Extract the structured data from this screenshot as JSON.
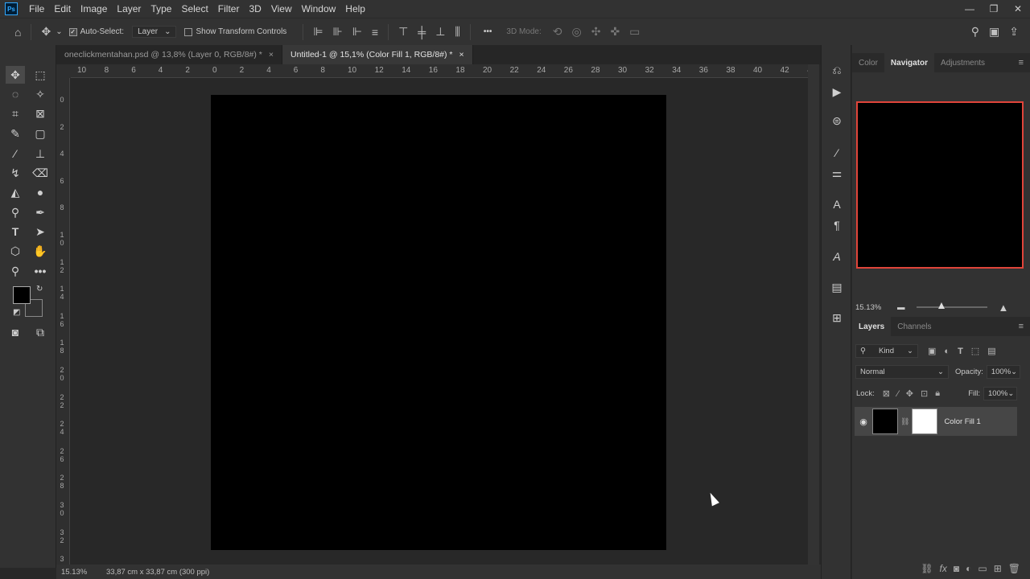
{
  "app": {
    "logo": "Ps"
  },
  "menu": [
    "File",
    "Edit",
    "Image",
    "Layer",
    "Type",
    "Select",
    "Filter",
    "3D",
    "View",
    "Window",
    "Help"
  ],
  "window_controls": {
    "minimize": "—",
    "restore": "❐",
    "close": "✕"
  },
  "options_bar": {
    "auto_select_label": "Auto-Select:",
    "auto_select_checked": "✓",
    "auto_select_target": "Layer",
    "transform_label": "Show Transform Controls",
    "mode_3d_label": "3D Mode:",
    "more": "•••"
  },
  "tabs": [
    {
      "label": "oneclickmentahan.psd @ 13,8% (Layer 0, RGB/8#) *",
      "close": "×",
      "active": false
    },
    {
      "label": "Untitled-1 @ 15,1% (Color Fill 1, RGB/8#) *",
      "close": "×",
      "active": true
    }
  ],
  "ruler_h": [
    "10",
    "8",
    "6",
    "4",
    "2",
    "0",
    "2",
    "4",
    "6",
    "8",
    "10",
    "12",
    "14",
    "16",
    "18",
    "20",
    "22",
    "24",
    "26",
    "28",
    "30",
    "32",
    "34",
    "36",
    "38",
    "40",
    "42",
    "4"
  ],
  "ruler_v": [
    "0",
    "2",
    "4",
    "6",
    "8",
    "1 0",
    "1 2",
    "1 4",
    "1 6",
    "1 8",
    "2 0",
    "2 2",
    "2 4",
    "2 6",
    "2 8",
    "3 0",
    "3 2",
    "3"
  ],
  "status": {
    "zoom": "15.13%",
    "doc_size": "33,87 cm x 33,87 cm (300 ppi)"
  },
  "right_panel": {
    "top_tabs": [
      "Color",
      "Navigator",
      "Adjustments"
    ],
    "nav_zoom": "15.13%",
    "layer_tabs": [
      "Layers",
      "Channels"
    ],
    "kind_label": "Kind",
    "blend_mode": "Normal",
    "opacity_label": "Opacity:",
    "opacity_value": "100%",
    "lock_label": "Lock:",
    "fill_label": "Fill:",
    "fill_value": "100%",
    "layer_name": "Color Fill 1"
  },
  "colors": {
    "foreground": "#000000",
    "background": "#ffffff",
    "accent": "#e0443a"
  }
}
